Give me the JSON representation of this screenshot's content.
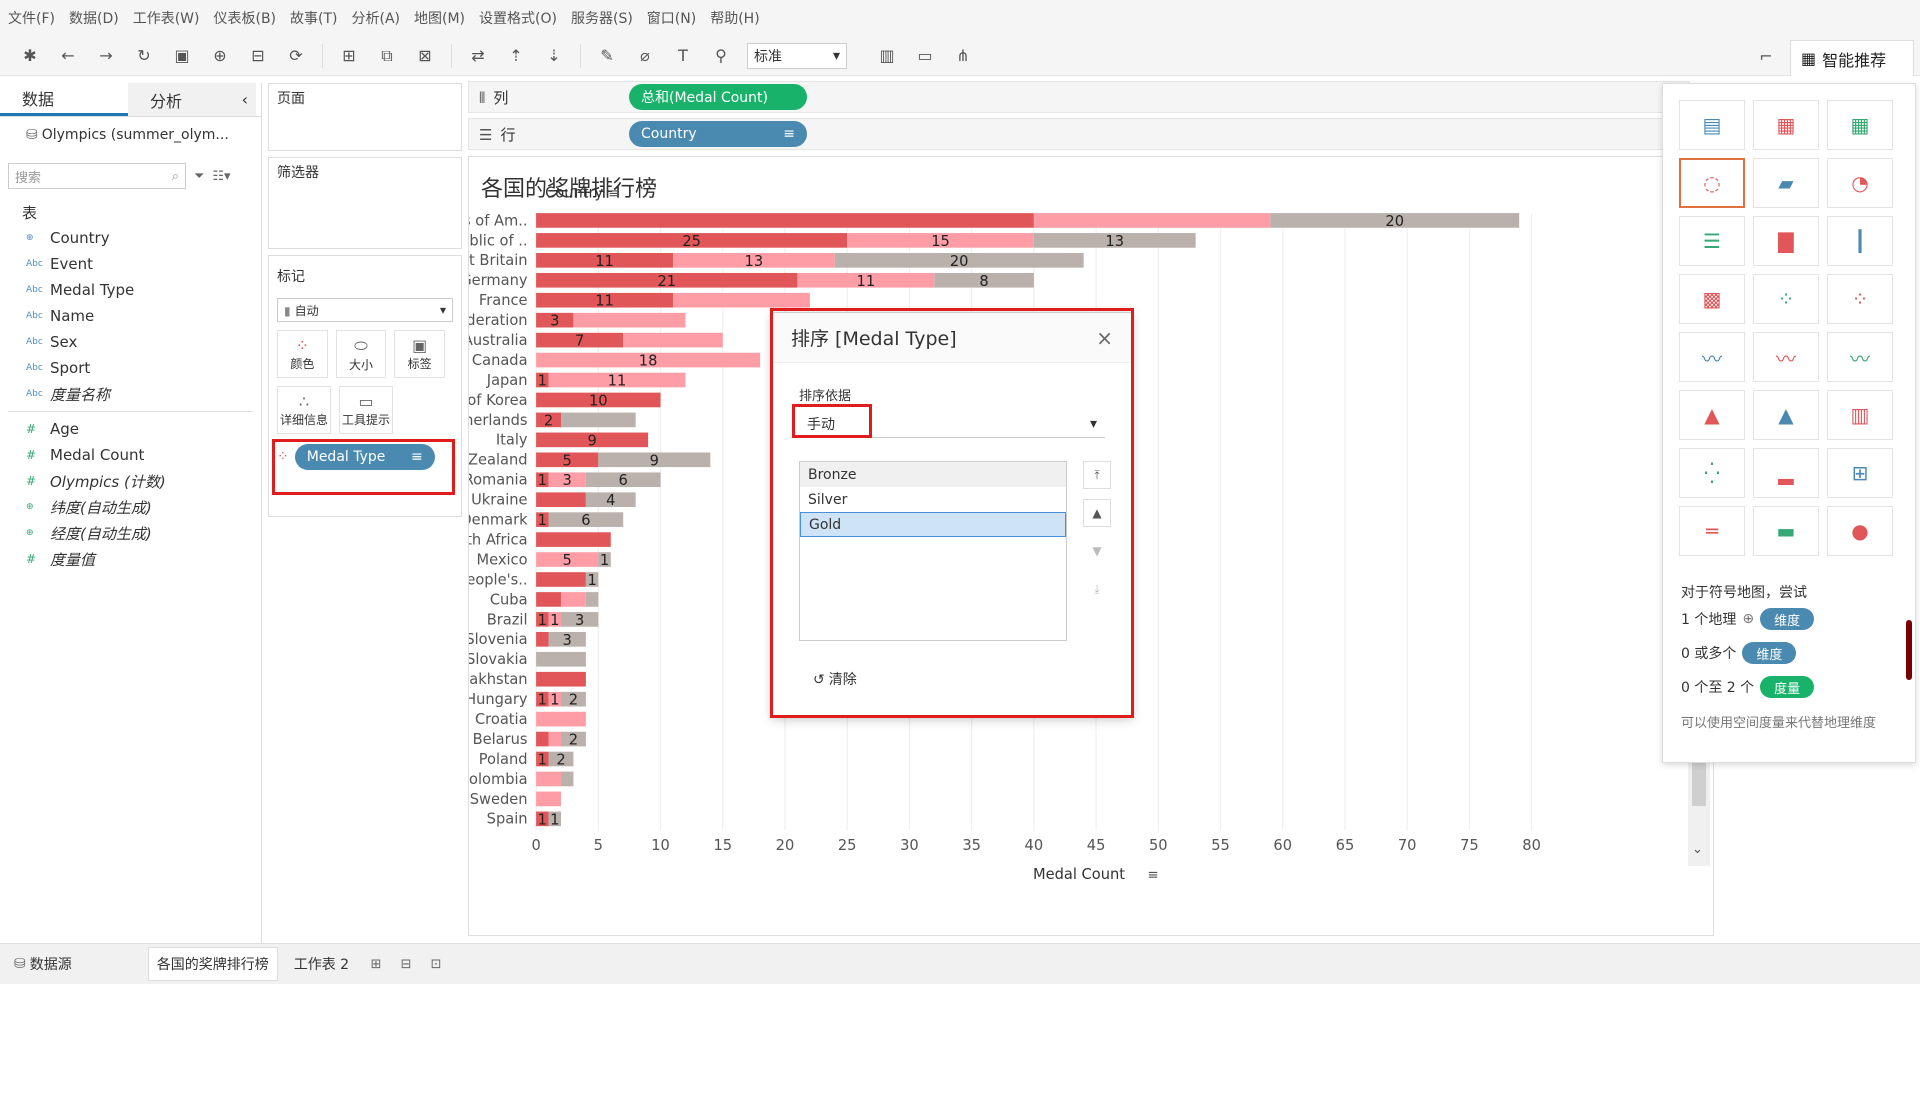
{
  "menu": [
    "文件(F)",
    "数据(D)",
    "工作表(W)",
    "仪表板(B)",
    "故事(T)",
    "分析(A)",
    "地图(M)",
    "设置格式(O)",
    "服务器(S)",
    "窗口(N)",
    "帮助(H)"
  ],
  "toolbar": {
    "fit_select": "标准",
    "smart_tab": "智能推荐"
  },
  "datapane": {
    "tab_data": "数据",
    "tab_analysis": "分析",
    "source": "Olympics (summer_olym...",
    "search_placeholder": "搜索",
    "section_table": "表",
    "dimensions": [
      "Country",
      "Event",
      "Medal Type",
      "Name",
      "Sex",
      "Sport",
      "度量名称"
    ],
    "measures": [
      "Age",
      "Medal Count",
      "Olympics (计数)",
      "纬度(自动生成)",
      "经度(自动生成)",
      "度量值"
    ]
  },
  "panes": {
    "pages": "页面",
    "filters": "筛选器",
    "marks": "标记",
    "mark_type": "自动",
    "btn_color": "颜色",
    "btn_size": "大小",
    "btn_label": "标签",
    "btn_detail": "详细信息",
    "btn_tooltip": "工具提示",
    "marks_pill": "Medal Type"
  },
  "shelves": {
    "columns_label": "列",
    "rows_label": "行",
    "columns_pill": "总和(Medal Count)",
    "rows_pill": "Country"
  },
  "colors": {
    "gold": "#e15759",
    "silver": "#ff9da7",
    "bronze": "#bab0ac"
  },
  "chart_data": {
    "type": "bar",
    "title": "各国的奖牌排行榜",
    "ylabel": "Country",
    "xlabel": "Medal Count",
    "xlim": [
      0,
      80
    ],
    "xticks": [
      0,
      5,
      10,
      15,
      20,
      25,
      30,
      35,
      40,
      45,
      50,
      55,
      60,
      65,
      70,
      75,
      80
    ],
    "categories": [
      "United States of Am..",
      "People's Republic of ..",
      "Great Britain",
      "Germany",
      "France",
      "Russian Federation",
      "Australia",
      "Canada",
      "Japan",
      "Republic of Korea",
      "Netherlands",
      "Italy",
      "New Zealand",
      "Romania",
      "Ukraine",
      "Denmark",
      "South Africa",
      "Mexico",
      "Democratic People's..",
      "Cuba",
      "Brazil",
      "Slovenia",
      "Slovakia",
      "Kazakhstan",
      "Hungary",
      "Croatia",
      "Belarus",
      "Poland",
      "Colombia",
      "Sweden",
      "Spain"
    ],
    "series": [
      {
        "name": "Gold",
        "values": [
          40,
          25,
          11,
          21,
          11,
          3,
          7,
          0,
          1,
          10,
          2,
          9,
          5,
          1,
          4,
          1,
          6,
          0,
          4,
          2,
          1,
          1,
          0,
          4,
          1,
          0,
          1,
          1,
          0,
          0,
          1
        ]
      },
      {
        "name": "Silver",
        "values": [
          19,
          15,
          13,
          11,
          11,
          9,
          8,
          18,
          11,
          0,
          0,
          0,
          0,
          3,
          0,
          0,
          0,
          5,
          0,
          2,
          1,
          0,
          0,
          0,
          1,
          4,
          1,
          0,
          2,
          2,
          0
        ]
      },
      {
        "name": "Bronze",
        "values": [
          20,
          13,
          20,
          8,
          0,
          0,
          0,
          0,
          0,
          0,
          6,
          0,
          9,
          6,
          4,
          6,
          0,
          1,
          1,
          1,
          3,
          3,
          4,
          0,
          2,
          0,
          2,
          2,
          1,
          0,
          1
        ]
      }
    ],
    "bar_labels": [
      [
        "",
        "",
        "20"
      ],
      [
        "25",
        "15",
        "13"
      ],
      [
        "11",
        "13",
        "20"
      ],
      [
        "21",
        "11",
        "8"
      ],
      [
        "11",
        "",
        ""
      ],
      [
        "3",
        "",
        ""
      ],
      [
        "7",
        "",
        ""
      ],
      [
        "",
        "18",
        ""
      ],
      [
        "1",
        "11",
        ""
      ],
      [
        "10",
        "",
        ""
      ],
      [
        "2",
        "",
        ""
      ],
      [
        "9",
        "",
        ""
      ],
      [
        "5",
        "",
        "9"
      ],
      [
        "1",
        "3",
        "6"
      ],
      [
        "",
        "",
        "4"
      ],
      [
        "1",
        "",
        "6"
      ],
      [
        "",
        "",
        ""
      ],
      [
        "",
        "5",
        "1"
      ],
      [
        "",
        "",
        "1"
      ],
      [
        "",
        "",
        ""
      ],
      [
        "1",
        "1",
        "3"
      ],
      [
        "",
        "",
        "3"
      ],
      [
        "",
        "",
        ""
      ],
      [
        "",
        "",
        ""
      ],
      [
        "1",
        "1",
        "2"
      ],
      [
        "",
        "",
        ""
      ],
      [
        "",
        "",
        "2"
      ],
      [
        "1",
        "",
        "2"
      ],
      [
        "",
        "",
        ""
      ],
      [
        "",
        "",
        ""
      ],
      [
        "1",
        "",
        "1"
      ]
    ]
  },
  "dialog": {
    "title": "排序 [Medal Type]",
    "sort_by_label": "排序依据",
    "sort_by_value": "手动",
    "items": [
      "Bronze",
      "Silver",
      "Gold"
    ],
    "selected": "Gold",
    "clear": "清除"
  },
  "smart": {
    "hint_title": "对于符号地图，尝试",
    "row1_text": "1 个地理",
    "row1_chip": "维度",
    "row2_text": "0 或多个",
    "row2_chip": "维度",
    "row3_text": "0 个至 2 个",
    "row3_chip": "度量",
    "note": "可以使用空间度量来代替地理维度"
  },
  "bottom": {
    "datasource": "数据源",
    "sheet1": "各国的奖牌排行榜",
    "sheet2": "工作表 2"
  }
}
